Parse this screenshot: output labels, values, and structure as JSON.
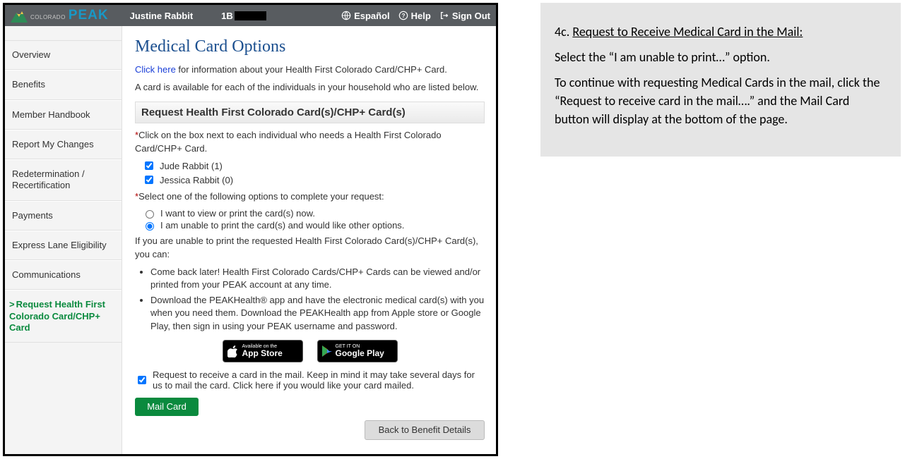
{
  "topbar": {
    "logo_sub": "COLORADO",
    "logo_main": "PEAK",
    "user_name": "Justine Rabbit",
    "case_prefix": "1B",
    "espanol": "Español",
    "help": "Help",
    "signout": "Sign Out"
  },
  "sidebar": {
    "items": [
      "Overview",
      "Benefits",
      "Member Handbook",
      "Report My Changes",
      "Redetermination / Recertification",
      "Payments",
      "Express Lane Eligibility",
      "Communications",
      "Request Health First Colorado Card/CHP+ Card"
    ]
  },
  "main": {
    "title": "Medical Card Options",
    "link_text": "Click here",
    "link_rest": " for information about your Health First Colorado Card/CHP+ Card.",
    "intro2": "A card is available for each of the individuals in your household who are listed below.",
    "sub_head": "Request Health First Colorado Card(s)/CHP+ Card(s)",
    "instruct1_rest": "Click on the box next to each individual who needs a Health First Colorado Card/CHP+ Card.",
    "members": [
      "Jude Rabbit (1)",
      "Jessica Rabbit (0)"
    ],
    "instruct2_rest": "Select one of the following options to complete your request:",
    "radios": [
      "I want to view or print the card(s) now.",
      "I am unable to print the card(s) and would like other options."
    ],
    "unable_lead": "If you are unable to print the requested Health First Colorado Card(s)/CHP+ Card(s), you can:",
    "bullets": [
      "Come back later! Health First Colorado Cards/CHP+ Cards can be viewed and/or printed from your PEAK account at any time.",
      "Download the PEAKHealth® app and have the electronic medical card(s) with you when you need them. Download the PEAKHealth app from Apple store or Google Play, then sign in using your PEAK username and password."
    ],
    "store_app_tiny": "Available on the",
    "store_app_big": "App Store",
    "store_gp_tiny": "GET IT ON",
    "store_gp_big": "Google Play",
    "mail_cb": "Request to receive a card in the mail. Keep in mind it may take several days for us to mail the card. Click here if you would like your card mailed.",
    "mail_btn": "Mail Card",
    "back_btn": "Back to Benefit Details"
  },
  "instr": {
    "step_no": "4c. ",
    "step_title": "Request to Receive Medical Card in the Mail:",
    "p1": "Select the “I am unable to print…” option.",
    "p2": "To continue with requesting Medical Cards in the mail, click  the “Request to receive card in the mail….” and the Mail Card button will display at the bottom of the page."
  }
}
